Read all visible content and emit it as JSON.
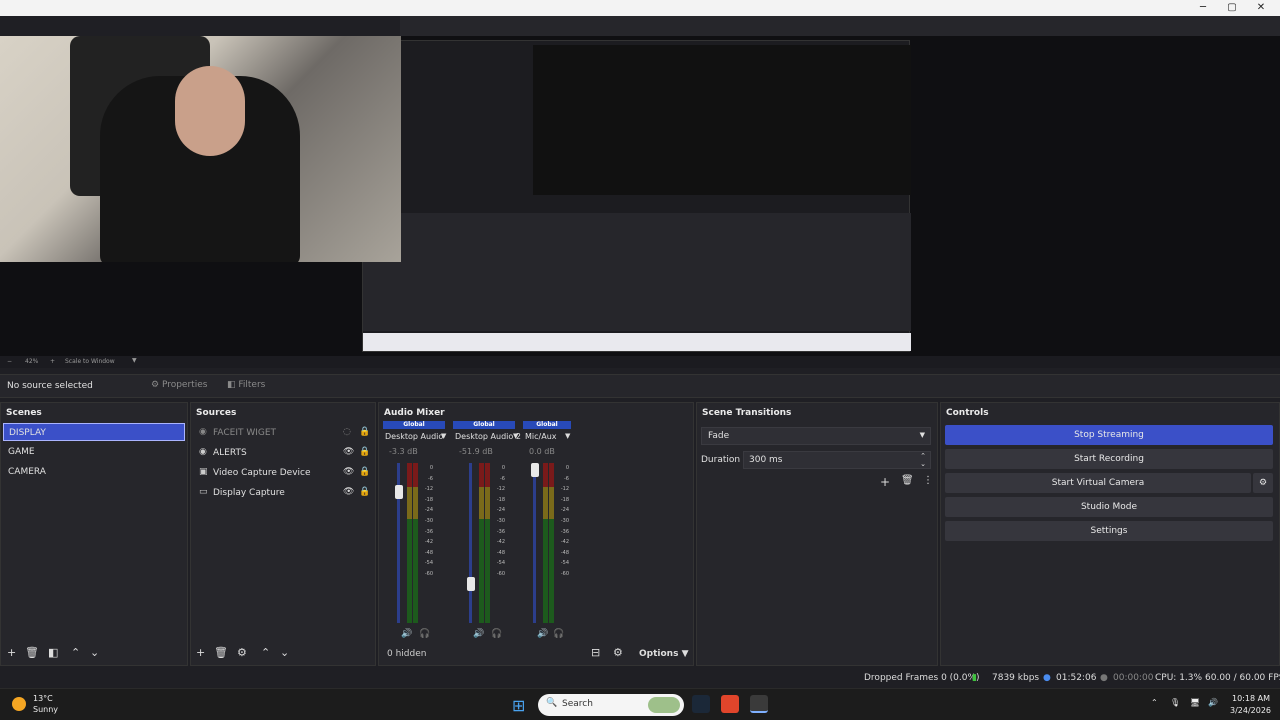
{
  "window": {
    "minimize": "─",
    "maximize": "▢",
    "close": "✕"
  },
  "zoom": {
    "level": "42%",
    "mode": "Scale to Window"
  },
  "source_bar": {
    "status": "No source selected",
    "properties": "Properties",
    "filters": "Filters"
  },
  "scenes": {
    "title": "Scenes",
    "items": [
      "DISPLAY",
      "GAME",
      "CAMERA"
    ],
    "selected": "DISPLAY"
  },
  "sources": {
    "title": "Sources",
    "items": [
      {
        "label": "FACEIT WIGET",
        "icon": "browser-source-icon",
        "hidden": true
      },
      {
        "label": "ALERTS",
        "icon": "browser-source-icon",
        "hidden": false
      },
      {
        "label": "Video Capture Device",
        "icon": "camera-icon",
        "hidden": false
      },
      {
        "label": "Display Capture",
        "icon": "monitor-icon",
        "hidden": false
      }
    ]
  },
  "audio_mixer": {
    "title": "Audio Mixer",
    "channels": [
      {
        "global": "Global",
        "name": "Desktop Audio",
        "db": "-3.3 dB",
        "fader_level": 0.85
      },
      {
        "global": "Global",
        "name": "Desktop Audio 2",
        "db": "-51.9 dB",
        "fader_level": 0.22
      },
      {
        "global": "Global",
        "name": "Mic/Aux",
        "db": "0.0 dB",
        "fader_level": 1.0
      }
    ],
    "scale": [
      "0",
      "-6",
      "-12",
      "-18",
      "-24",
      "-30",
      "-36",
      "-42",
      "-48",
      "-54",
      "-60"
    ],
    "hidden_count": "0 hidden",
    "options": "Options"
  },
  "scene_transitions": {
    "title": "Scene Transitions",
    "transition": "Fade",
    "duration_label": "Duration",
    "duration": "300 ms"
  },
  "controls": {
    "title": "Controls",
    "stop_streaming": "Stop Streaming",
    "start_recording": "Start Recording",
    "start_virtual_camera": "Start Virtual Camera",
    "studio_mode": "Studio Mode",
    "settings": "Settings"
  },
  "status": {
    "dropped_frames": "Dropped Frames 0 (0.0%)",
    "bitrate": "7839 kbps",
    "stream_time": "01:52:06",
    "rec_time": "00:00:00",
    "cpu": "CPU: 1.3%",
    "fps": "60.00 / 60.00 FPS"
  },
  "taskbar": {
    "weather_temp": "13°C",
    "weather_desc": "Sunny",
    "search": "Search",
    "time": "10:18 AM",
    "date": "3/24/2026"
  },
  "colors": {
    "accent": "#3b50c8",
    "panel": "#26262b",
    "background": "#1f1f24"
  }
}
